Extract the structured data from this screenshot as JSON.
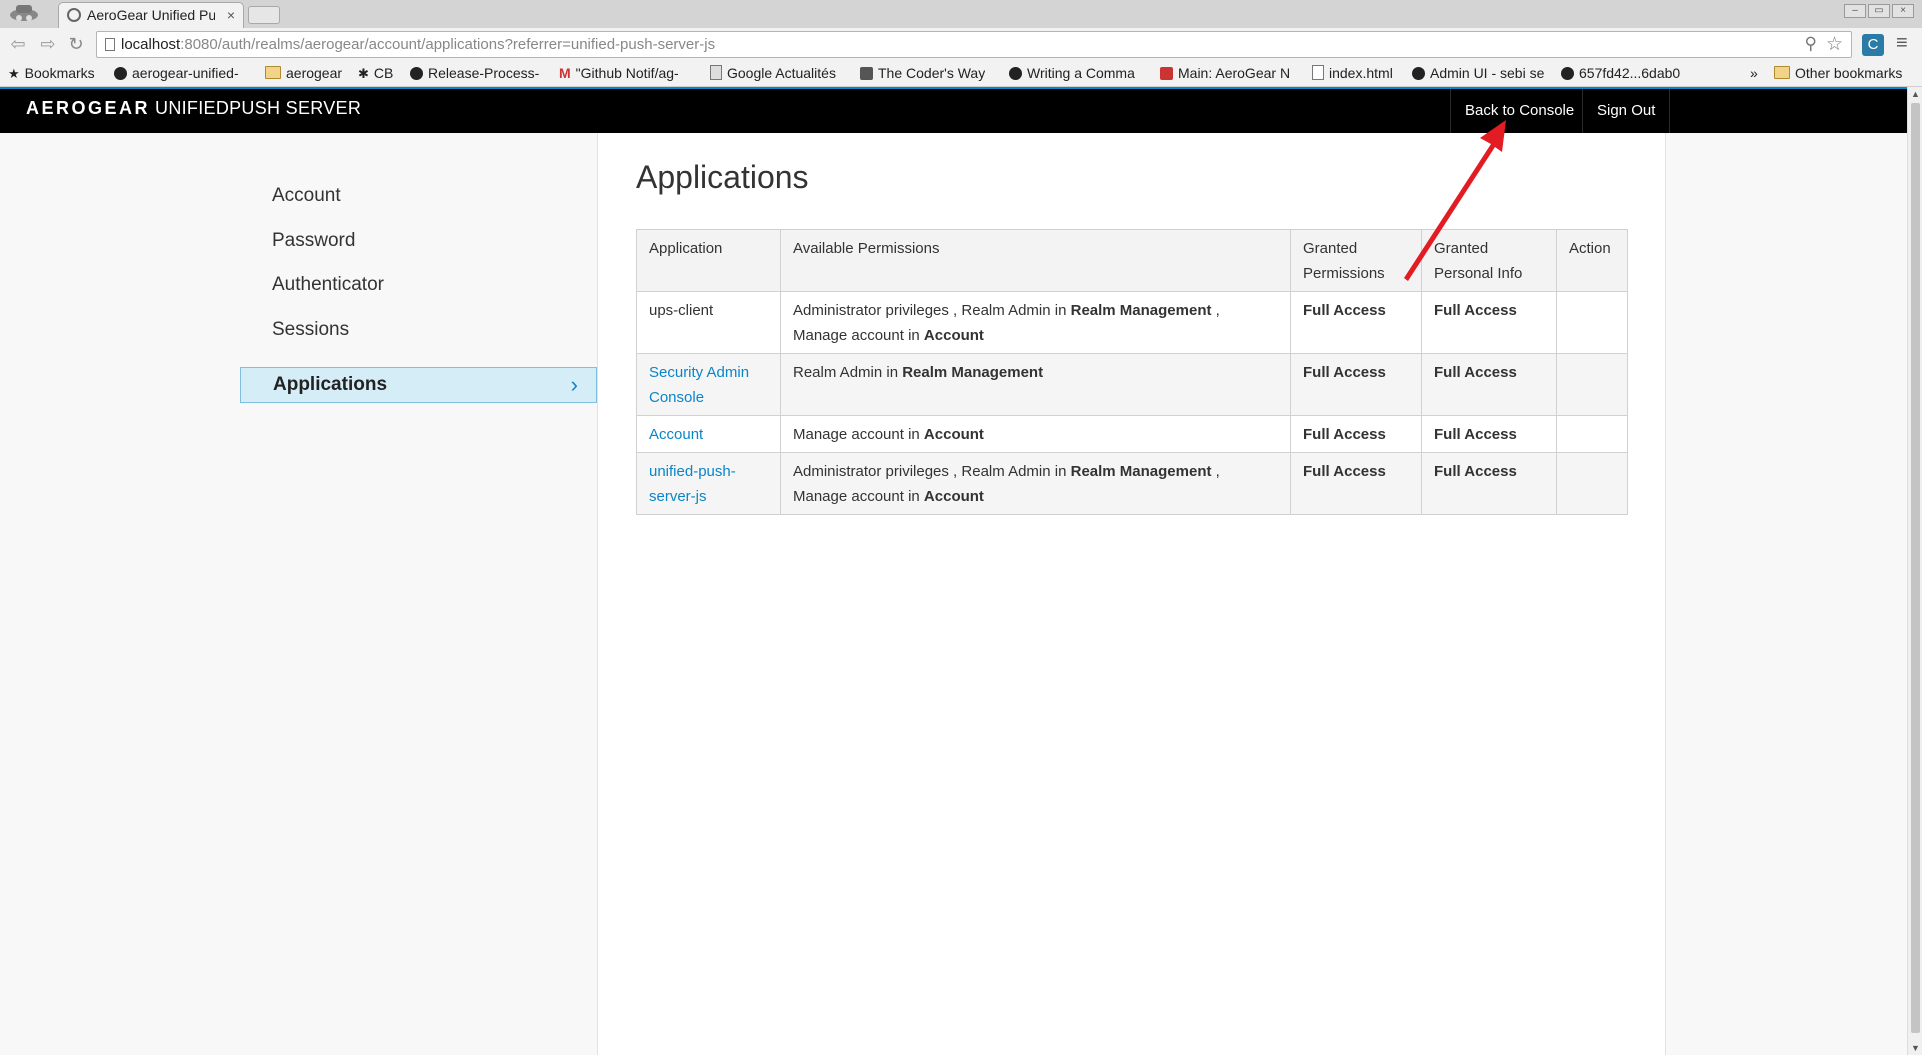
{
  "browser": {
    "tab_title": "AeroGear Unified Pus",
    "url_host": "localhost",
    "url_rest": ":8080/auth/realms/aerogear/account/applications?referrer=unified-push-server-js",
    "bookmarks": [
      "Bookmarks",
      "aerogear-unified-",
      "aerogear",
      "CB",
      "Release-Process-",
      "\"Github Notif/ag-",
      "Google Actualités",
      "The Coder's Way",
      "Writing a Comma",
      "Main: AeroGear N",
      "index.html",
      "Admin UI - sebi se",
      "657fd42...6dab0"
    ],
    "overflow": "»",
    "other_bookmarks": "Other bookmarks"
  },
  "header": {
    "brand_strong": "AEROGEAR",
    "brand_light": "UNIFIEDPUSH SERVER",
    "back_to_console": "Back to Console",
    "sign_out": "Sign Out"
  },
  "sidebar": {
    "items": [
      {
        "label": "Account"
      },
      {
        "label": "Password"
      },
      {
        "label": "Authenticator"
      },
      {
        "label": "Sessions"
      },
      {
        "label": "Applications"
      }
    ]
  },
  "main": {
    "title": "Applications",
    "table": {
      "headers": {
        "application": "Application",
        "permissions": "Available Permissions",
        "granted_line1": "Granted",
        "granted_line2": "Permissions",
        "personal_line1": "Granted",
        "personal_line2": "Personal Info",
        "action": "Action"
      },
      "rows": [
        {
          "app": "ups-client",
          "p1": "Administrator privileges , Realm Admin in ",
          "p1b": "Realm Management",
          "p2": " ,",
          "p3": "Manage account in ",
          "p3b": "Account",
          "granted": "Full Access",
          "personal": "Full Access"
        },
        {
          "app_line1": "Security Admin",
          "app_line2": "Console",
          "p1": "Realm Admin in ",
          "p1b": "Realm Management",
          "granted": "Full Access",
          "personal": "Full Access"
        },
        {
          "app": "Account",
          "p1": "Manage account in ",
          "p1b": "Account",
          "granted": "Full Access",
          "personal": "Full Access"
        },
        {
          "app_line1": "unified-push-",
          "app_line2": "server-js",
          "p1": "Administrator privileges , Realm Admin in ",
          "p1b": "Realm Management",
          "p2": " ,",
          "p3": "Manage account in ",
          "p3b": "Account",
          "granted": "Full Access",
          "personal": "Full Access"
        }
      ]
    }
  },
  "colors": {
    "accent": "#0a85c8",
    "header_bg": "#000000",
    "active_bg": "#d4edf7",
    "annotation_arrow": "#e31b23"
  }
}
